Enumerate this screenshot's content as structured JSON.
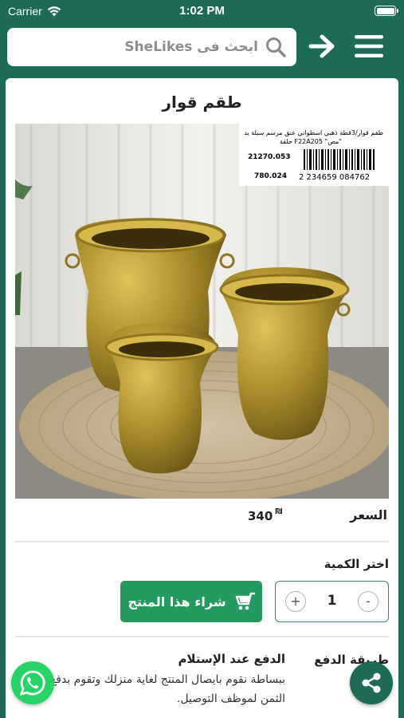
{
  "status_bar": {
    "carrier": "Carrier",
    "time": "1:02 PM"
  },
  "header": {
    "search_placeholder": "ابحث فى SheLikes"
  },
  "product": {
    "title": "طقم قوار",
    "image_tag": {
      "line1": "طقم قوار/3قطة ذهبي اسطواني عنق مرسم سيلة يد",
      "line2": "حلقة F22A205 \"مص\"",
      "code1": "21270.053",
      "code2": "780.024",
      "barcode": "2 234659 084762"
    },
    "price_label": "السعر",
    "price_value": "340",
    "currency": "₪"
  },
  "quantity": {
    "label": "اختر الكمية",
    "value": "1",
    "plus": "+",
    "minus": "-"
  },
  "buy_button": {
    "label": "شراء هذا المنتج"
  },
  "payment": {
    "label": "طريقة الدفع",
    "method": "الدفع عند الإستلام",
    "description": "ببساطة نقوم بايصال المنتج لغاية منزلك وتقوم بدفع الثمن لموظف التوصيل."
  },
  "icons": {
    "wifi": "wifi-icon",
    "battery": "battery-icon",
    "search": "search-icon",
    "back": "arrow-right-icon",
    "menu": "hamburger-menu-icon",
    "cart": "cart-icon",
    "whatsapp": "whatsapp-icon",
    "share": "share-icon"
  },
  "colors": {
    "brand": "#1d6a57",
    "buy_button": "#239a5f",
    "whatsapp": "#25d366"
  }
}
